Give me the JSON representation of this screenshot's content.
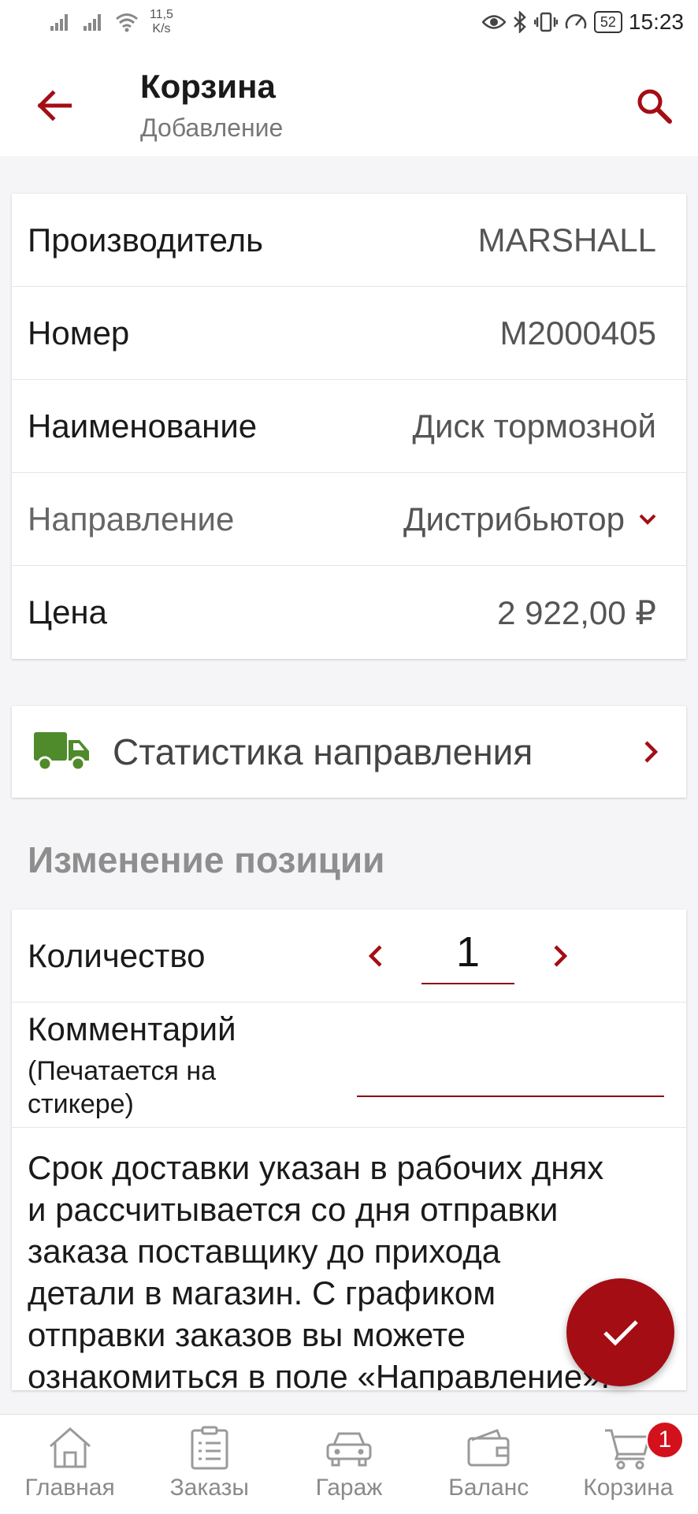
{
  "status_bar": {
    "speed_value": "11,5",
    "speed_unit": "K/s",
    "battery": "52",
    "time": "15:23"
  },
  "header": {
    "title": "Корзина",
    "subtitle": "Добавление"
  },
  "details": {
    "manufacturer_label": "Производитель",
    "manufacturer_value": "MARSHALL",
    "number_label": "Номер",
    "number_value": "M2000405",
    "name_label": "Наименование",
    "name_value": "Диск тормозной",
    "direction_label": "Направление",
    "direction_value": "Дистрибьютор",
    "price_label": "Цена",
    "price_value": "2 922,00 ₽"
  },
  "stats": {
    "label": "Статистика направления"
  },
  "edit": {
    "section_title": "Изменение позиции",
    "quantity_label": "Количество",
    "quantity_value": "1",
    "comment_label": "Комментарий",
    "comment_sublabel": "(Печатается на стикере)",
    "info_lines": [
      "Срок доставки указан в рабочих днях",
      "и рассчитывается со дня отправки",
      "заказа поставщику до прихода",
      "детали в магазин. С графиком",
      "отправки заказов вы можете",
      "ознакомиться в поле «Направление»."
    ]
  },
  "nav": {
    "items": [
      {
        "label": "Главная",
        "icon": "home-icon"
      },
      {
        "label": "Заказы",
        "icon": "clipboard-icon"
      },
      {
        "label": "Гараж",
        "icon": "car-icon"
      },
      {
        "label": "Баланс",
        "icon": "wallet-icon"
      },
      {
        "label": "Корзина",
        "icon": "cart-icon"
      }
    ],
    "cart_badge": "1"
  },
  "colors": {
    "accent": "#a40d14",
    "truck": "#4f8a2b",
    "badge": "#d3111c"
  }
}
